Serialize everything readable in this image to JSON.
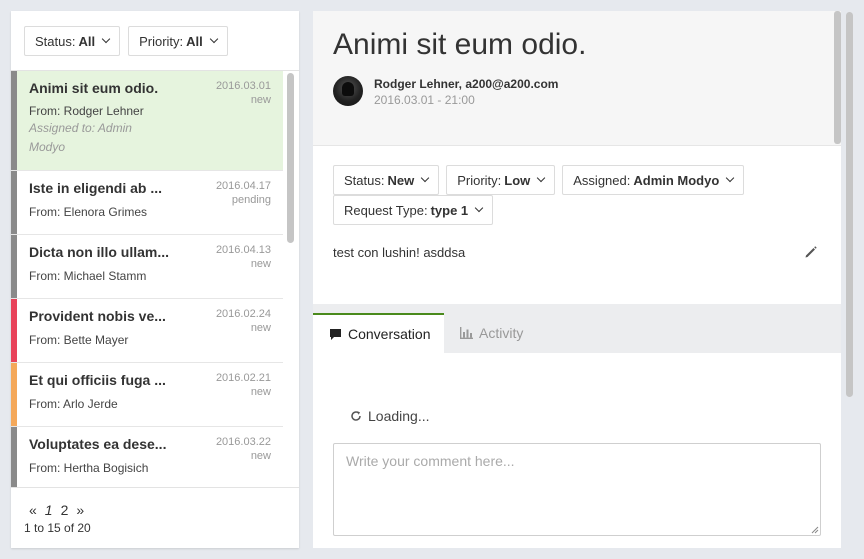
{
  "filters": {
    "status": {
      "label": "Status:",
      "value": "All"
    },
    "priority": {
      "label": "Priority:",
      "value": "All"
    }
  },
  "tickets": [
    {
      "title": "Animi sit eum odio.",
      "from": "From: Rodger Lehner",
      "assigned": "Assigned to: Admin Modyo",
      "date": "2016.03.01",
      "status": "new",
      "color": "#8a8a8a"
    },
    {
      "title": "Iste in eligendi ab ...",
      "from": "From: Elenora Grimes",
      "date": "2016.04.17",
      "status": "pending",
      "color": "#8a8a8a"
    },
    {
      "title": "Dicta non illo ullam...",
      "from": "From: Michael Stamm",
      "date": "2016.04.13",
      "status": "new",
      "color": "#8a8a8a"
    },
    {
      "title": "Provident nobis ve...",
      "from": "From: Bette Mayer",
      "date": "2016.02.24",
      "status": "new",
      "color": "#e8425a"
    },
    {
      "title": "Et qui officiis fuga ...",
      "from": "From: Arlo Jerde",
      "date": "2016.02.21",
      "status": "new",
      "color": "#f4a85a"
    },
    {
      "title": "Voluptates ea dese...",
      "from": "From: Hertha Bogisich",
      "date": "2016.03.22",
      "status": "new",
      "color": "#8a8a8a"
    }
  ],
  "pagination": {
    "prev": "«",
    "page1": "1",
    "page2": "2",
    "next": "»",
    "range": "1 to 15 of 20"
  },
  "detail": {
    "title": "Animi sit eum odio.",
    "author": "Rodger Lehner, a200@a200.com",
    "datetime": "2016.03.01 - 21:00",
    "status": {
      "label": "Status:",
      "value": "New"
    },
    "priority": {
      "label": "Priority:",
      "value": "Low"
    },
    "assigned": {
      "label": "Assigned:",
      "value": "Admin Modyo"
    },
    "request_type": {
      "label": "Request Type:",
      "value": "type 1"
    },
    "description": "test con lushin! asddsa"
  },
  "tabs": {
    "conversation": "Conversation",
    "activity": "Activity"
  },
  "loading": "Loading...",
  "comment": {
    "placeholder": "Write your comment here..."
  },
  "icons": {
    "edit": "pencil-icon",
    "chat": "chat-bubble-icon",
    "activity": "bar-chart-icon",
    "loading": "refresh-icon"
  }
}
